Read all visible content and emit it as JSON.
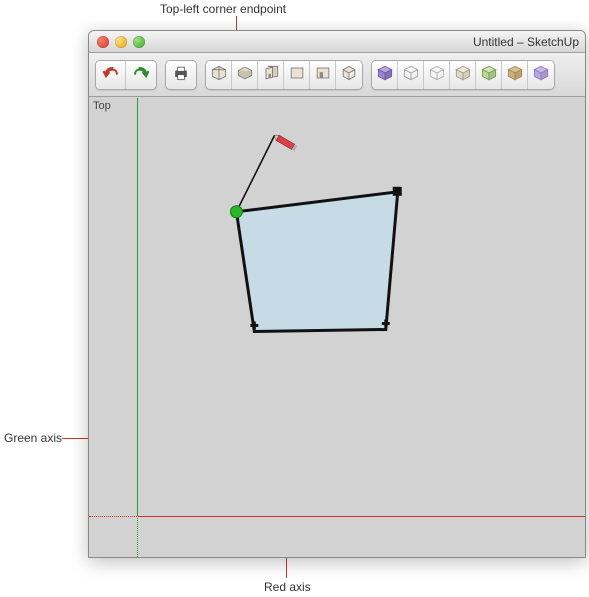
{
  "annotations": {
    "top_left_endpoint": "Top-left corner endpoint",
    "green_axis": "Green axis",
    "red_axis": "Red axis"
  },
  "window": {
    "title": "Untitled – SketchUp"
  },
  "canvas": {
    "view_label": "Top"
  },
  "colors": {
    "green_axis": "#1ea81e",
    "red_axis": "#d4302a",
    "face_fill": "#c7dbe6",
    "endpoint_highlight": "#28b828"
  },
  "toolbar": {
    "groups": [
      {
        "name": "history",
        "buttons": [
          "undo",
          "redo"
        ]
      },
      {
        "name": "print",
        "buttons": [
          "print"
        ]
      },
      {
        "name": "views",
        "buttons": [
          "iso",
          "top",
          "front",
          "right",
          "back",
          "left"
        ]
      },
      {
        "name": "styles",
        "buttons": [
          "style1",
          "style2",
          "style3",
          "style4",
          "style5",
          "style6",
          "style7"
        ]
      }
    ]
  }
}
